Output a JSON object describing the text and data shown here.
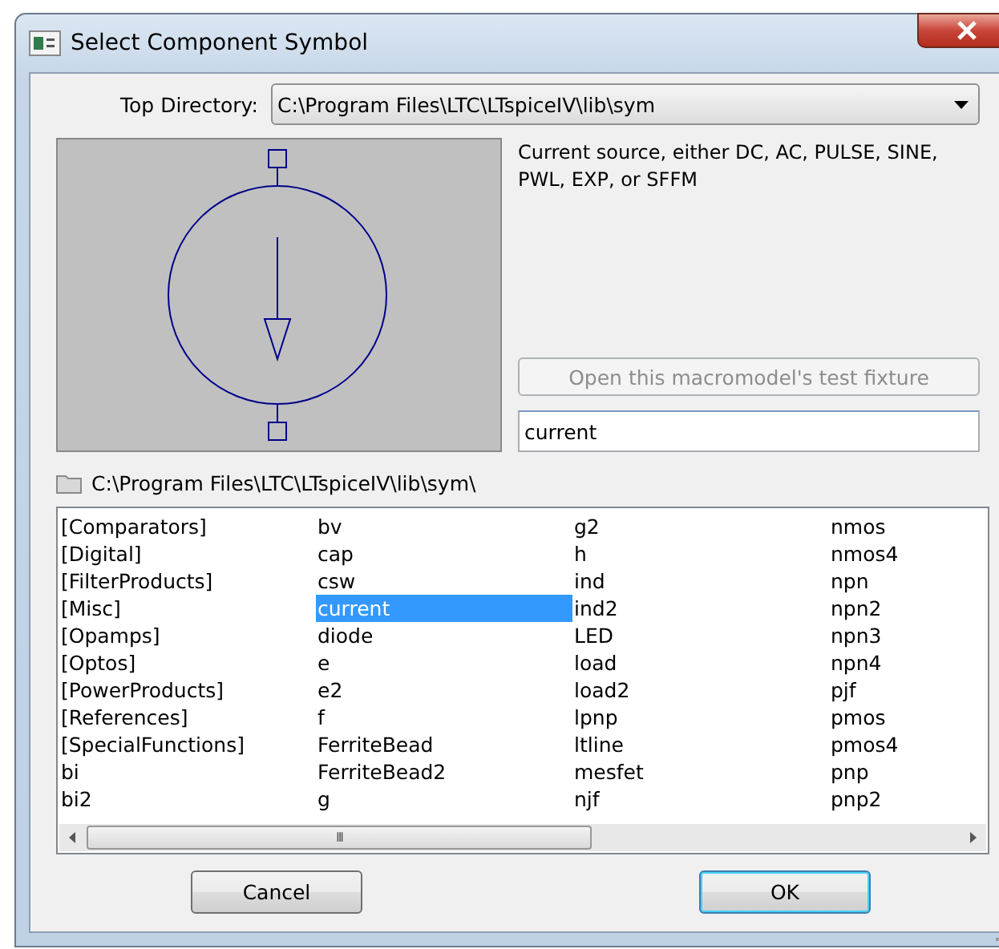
{
  "window": {
    "title": "Select Component Symbol"
  },
  "top_directory": {
    "label": "Top Directory:",
    "value": "C:\\Program Files\\LTC\\LTspiceIV\\lib\\sym"
  },
  "description": "Current source, either DC, AC, PULSE, SINE, PWL, EXP, or SFFM",
  "test_fixture_button": {
    "label": "Open this macromodel's test fixture",
    "disabled": true
  },
  "search": {
    "value": "current"
  },
  "path": "C:\\Program Files\\LTC\\LTspiceIV\\lib\\sym\\",
  "list_columns": [
    [
      {
        "label": "[Comparators]",
        "selected": false
      },
      {
        "label": "[Digital]",
        "selected": false
      },
      {
        "label": "[FilterProducts]",
        "selected": false
      },
      {
        "label": "[Misc]",
        "selected": false
      },
      {
        "label": "[Opamps]",
        "selected": false
      },
      {
        "label": "[Optos]",
        "selected": false
      },
      {
        "label": "[PowerProducts]",
        "selected": false
      },
      {
        "label": "[References]",
        "selected": false
      },
      {
        "label": "[SpecialFunctions]",
        "selected": false
      },
      {
        "label": "bi",
        "selected": false
      },
      {
        "label": "bi2",
        "selected": false
      }
    ],
    [
      {
        "label": "bv",
        "selected": false
      },
      {
        "label": "cap",
        "selected": false
      },
      {
        "label": "csw",
        "selected": false
      },
      {
        "label": "current",
        "selected": true
      },
      {
        "label": "diode",
        "selected": false
      },
      {
        "label": "e",
        "selected": false
      },
      {
        "label": "e2",
        "selected": false
      },
      {
        "label": "f",
        "selected": false
      },
      {
        "label": "FerriteBead",
        "selected": false
      },
      {
        "label": "FerriteBead2",
        "selected": false
      },
      {
        "label": "g",
        "selected": false
      }
    ],
    [
      {
        "label": "g2",
        "selected": false
      },
      {
        "label": "h",
        "selected": false
      },
      {
        "label": "ind",
        "selected": false
      },
      {
        "label": "ind2",
        "selected": false
      },
      {
        "label": "LED",
        "selected": false
      },
      {
        "label": "load",
        "selected": false
      },
      {
        "label": "load2",
        "selected": false
      },
      {
        "label": "lpnp",
        "selected": false
      },
      {
        "label": "ltline",
        "selected": false
      },
      {
        "label": "mesfet",
        "selected": false
      },
      {
        "label": "njf",
        "selected": false
      }
    ],
    [
      {
        "label": "nmos",
        "selected": false
      },
      {
        "label": "nmos4",
        "selected": false
      },
      {
        "label": "npn",
        "selected": false
      },
      {
        "label": "npn2",
        "selected": false
      },
      {
        "label": "npn3",
        "selected": false
      },
      {
        "label": "npn4",
        "selected": false
      },
      {
        "label": "pjf",
        "selected": false
      },
      {
        "label": "pmos",
        "selected": false
      },
      {
        "label": "pmos4",
        "selected": false
      },
      {
        "label": "pnp",
        "selected": false
      },
      {
        "label": "pnp2",
        "selected": false
      }
    ]
  ],
  "scroll_thumb": "III",
  "buttons": [
    {
      "label": "Cancel",
      "default": false
    },
    {
      "label": "OK",
      "default": true
    }
  ]
}
